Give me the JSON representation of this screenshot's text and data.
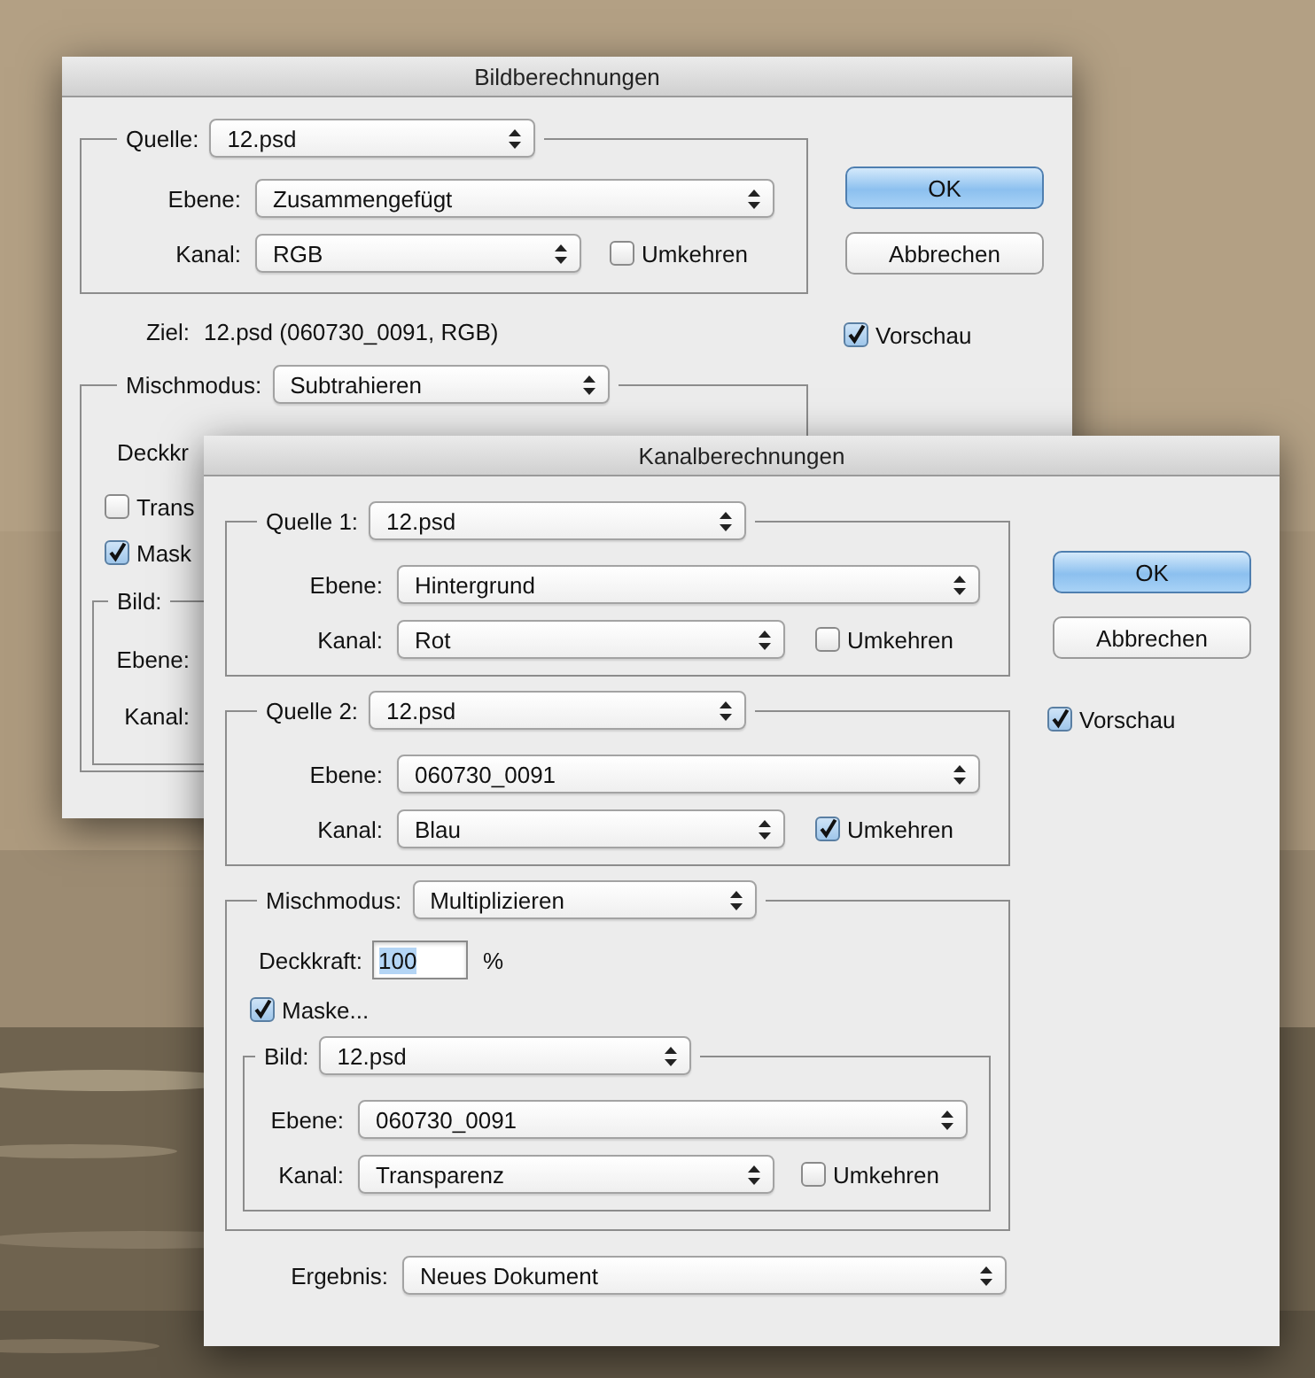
{
  "back_dialog": {
    "title": "Bildberechnungen",
    "source": {
      "label": "Quelle:",
      "value": "12.psd",
      "layer": {
        "label": "Ebene:",
        "value": "Zusammengefügt"
      },
      "channel": {
        "label": "Kanal:",
        "value": "RGB"
      },
      "invert": {
        "label": "Umkehren",
        "checked": false
      }
    },
    "target": {
      "label": "Ziel:",
      "value": "12.psd (060730_0091, RGB)"
    },
    "blend": {
      "label": "Mischmodus:",
      "value": "Subtrahieren",
      "opacity_label": "Deckkr",
      "transparency": {
        "label": "Trans",
        "checked": false
      },
      "mask": {
        "label": "Mask",
        "checked": true
      },
      "image": {
        "label": "Bild:",
        "layer_label": "Ebene:",
        "channel_label": "Kanal:"
      }
    },
    "buttons": [
      {
        "label": "OK",
        "default": true
      },
      {
        "label": "Abbrechen",
        "default": false
      }
    ],
    "preview": {
      "label": "Vorschau",
      "checked": true
    }
  },
  "front_dialog": {
    "title": "Kanalberechnungen",
    "sources": [
      {
        "label": "Quelle 1:",
        "value": "12.psd",
        "layer": {
          "label": "Ebene:",
          "value": "Hintergrund"
        },
        "channel": {
          "label": "Kanal:",
          "value": "Rot"
        },
        "invert": {
          "label": "Umkehren",
          "checked": false
        }
      },
      {
        "label": "Quelle 2:",
        "value": "12.psd",
        "layer": {
          "label": "Ebene:",
          "value": "060730_0091"
        },
        "channel": {
          "label": "Kanal:",
          "value": "Blau"
        },
        "invert": {
          "label": "Umkehren",
          "checked": true
        }
      }
    ],
    "blend": {
      "label": "Mischmodus:",
      "value": "Multiplizieren",
      "opacity": {
        "label": "Deckkraft:",
        "value": "100",
        "unit": "%"
      },
      "mask": {
        "label": "Maske...",
        "checked": true,
        "image": {
          "label": "Bild:",
          "value": "12.psd",
          "layer": {
            "label": "Ebene:",
            "value": "060730_0091"
          },
          "channel": {
            "label": "Kanal:",
            "value": "Transparenz"
          },
          "invert": {
            "label": "Umkehren",
            "checked": false
          }
        }
      }
    },
    "result": {
      "label": "Ergebnis:",
      "value": "Neues Dokument"
    },
    "buttons": [
      {
        "label": "OK",
        "default": true
      },
      {
        "label": "Abbrechen",
        "default": false
      }
    ],
    "preview": {
      "label": "Vorschau",
      "checked": true
    }
  }
}
